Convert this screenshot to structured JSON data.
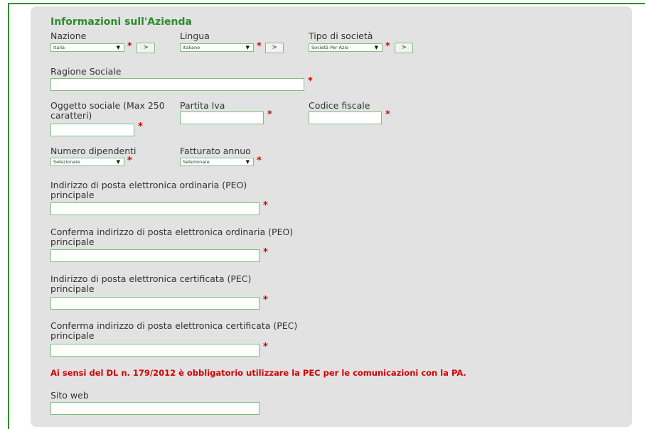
{
  "section_title": "Informazioni sull'Azienda",
  "nazione": {
    "label": "Nazione",
    "value": "Italia",
    "go": ">"
  },
  "lingua": {
    "label": "Lingua",
    "value": "Italiano",
    "go": ">"
  },
  "tipo_societa": {
    "label": "Tipo di società",
    "value": "Società Per Azio",
    "go": ">"
  },
  "ragione_sociale": {
    "label": "Ragione Sociale"
  },
  "oggetto_sociale": {
    "label": "Oggetto sociale (Max 250 caratteri)"
  },
  "partita_iva": {
    "label": "Partita Iva"
  },
  "codice_fiscale": {
    "label": "Codice fiscale"
  },
  "numero_dipendenti": {
    "label": "Numero dipendenti",
    "value": "Selezionare"
  },
  "fatturato_annuo": {
    "label": "Fatturato annuo",
    "value": "Selezionare"
  },
  "peo": {
    "label": "Indirizzo di posta elettronica ordinaria (PEO) principale"
  },
  "peo_confirm": {
    "label": "Conferma indirizzo di posta elettronica ordinaria (PEO) principale"
  },
  "pec": {
    "label": "Indirizzo di posta elettronica certificata (PEC) principale"
  },
  "pec_confirm": {
    "label": "Conferma indirizzo di posta elettronica certificata (PEC) principale"
  },
  "notice": "Ai sensi del DL n. 179/2012 è obbligatorio utilizzare la PEC per le comunicazioni con la PA.",
  "sito_web": {
    "label": "Sito web"
  },
  "required_mark": "*",
  "dropdown_arrow": "▼",
  "colors": {
    "accent": "#2e8b2e",
    "required": "#d40000",
    "panel": "#e2e2e2",
    "field_border": "#7cc17c"
  }
}
